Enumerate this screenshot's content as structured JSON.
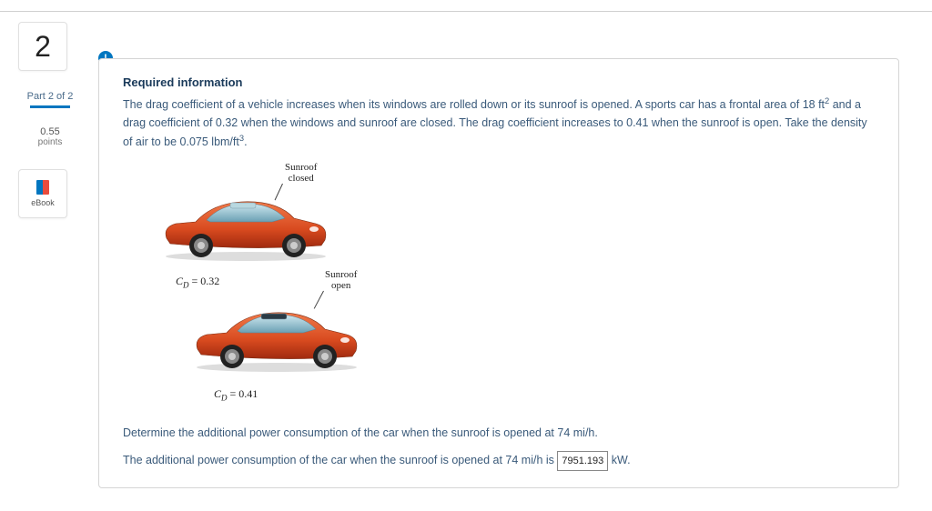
{
  "sidebar": {
    "question_number": "2",
    "part_label": "Part 2 of 2",
    "points_value": "0.55",
    "points_label": "points",
    "ebook_label": "eBook"
  },
  "alert_icon_glyph": "!",
  "panel": {
    "required_heading": "Required information",
    "required_text_1": "The drag coefficient of a vehicle increases when its windows are rolled down or its sunroof is opened. A sports car has a frontal area of 18 ft",
    "required_text_sup1": "2",
    "required_text_2": " and a drag coefficient of 0.32 when the windows and sunroof are closed. The drag coefficient increases to 0.41 when the sunroof is open. Take the density of air to be 0.075 lbm/ft",
    "required_text_sup2": "3",
    "required_text_3": "."
  },
  "diagram": {
    "annotation_closed_l1": "Sunroof",
    "annotation_closed_l2": "closed",
    "label_closed_cd": "C",
    "label_closed_sub": "D",
    "label_closed_eq": " = 0.32",
    "annotation_open_l1": "Sunroof",
    "annotation_open_l2": "open",
    "label_open_cd": "C",
    "label_open_sub": "D",
    "label_open_eq": " = 0.41"
  },
  "question": {
    "prompt": "Determine the additional power consumption of the car when the sunroof is opened at 74 mi/h.",
    "answer_prefix": "The additional power consumption of the car when the sunroof is opened at 74 mi/h is ",
    "answer_value": "7951.193",
    "answer_suffix": " kW."
  }
}
